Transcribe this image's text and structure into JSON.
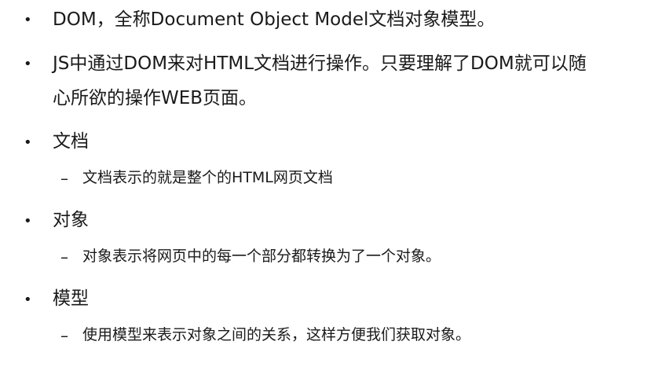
{
  "slide": {
    "bullet_symbol": "•",
    "dash_symbol": "–",
    "items": [
      {
        "text": "DOM，全称Document Object Model文档对象模型。"
      },
      {
        "text_line1": "JS中通过DOM来对HTML文档进行操作。只要理解了DOM就可以随",
        "text_line2": "心所欲的操作WEB页面。"
      },
      {
        "text": "文档",
        "sub": "文档表示的就是整个的HTML网页文档"
      },
      {
        "text": "对象",
        "sub": "对象表示将网页中的每一个部分都转换为了一个对象。"
      },
      {
        "text": "模型",
        "sub": "使用模型来表示对象之间的关系，这样方便我们获取对象。"
      }
    ]
  }
}
